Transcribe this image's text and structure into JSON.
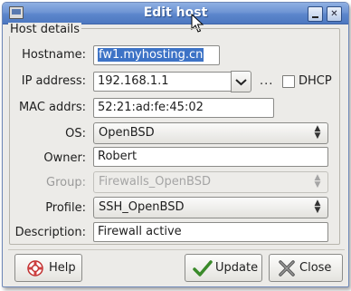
{
  "window": {
    "title": "Edit host",
    "titlebar_icon": "window-icon",
    "minimize_icon": "minimize-icon",
    "close_icon": "close-icon"
  },
  "frame": {
    "label": "Host details"
  },
  "fields": {
    "hostname": {
      "label": "Hostname:",
      "value": "fw1.myhosting.cn"
    },
    "ip": {
      "label": "IP address:",
      "value": "192.168.1.1",
      "ellipsis": "...",
      "dhcp_label": "DHCP",
      "dhcp_checked": false
    },
    "mac": {
      "label": "MAC addrs:",
      "value": "52:21:ad:fe:45:02"
    },
    "os": {
      "label": "OS:",
      "value": "OpenBSD"
    },
    "owner": {
      "label": "Owner:",
      "value": "Robert"
    },
    "group": {
      "label": "Group:",
      "value": "Firewalls_OpenBSD",
      "disabled": true
    },
    "profile": {
      "label": "Profile:",
      "value": "SSH_OpenBSD"
    },
    "description": {
      "label": "Description:",
      "value": "Firewall active"
    }
  },
  "buttons": {
    "help": {
      "label": "Help",
      "icon": "help-lifebuoy-icon"
    },
    "update": {
      "label": "Update",
      "icon": "checkmark-icon"
    },
    "close": {
      "label": "Close",
      "icon": "close-x-icon"
    }
  },
  "colors": {
    "titlebar": "#5c86cc",
    "selection": "#3d73c6",
    "dialog_bg": "#ecebe8"
  }
}
